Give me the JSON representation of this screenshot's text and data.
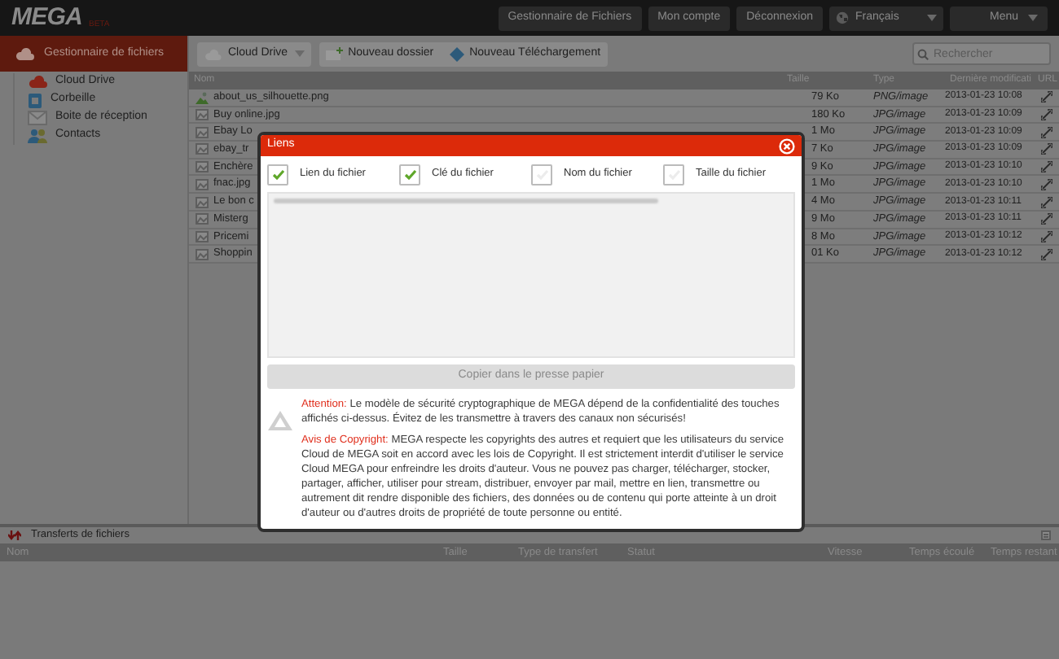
{
  "topbar": {
    "logo": "MEGA",
    "beta": "BETA",
    "nav": [
      "Gestionnaire de Fichiers",
      "Mon compte",
      "Déconnexion"
    ],
    "language": "Français",
    "menu": "Menu"
  },
  "sidebar": {
    "header": "Gestionnaire de fichiers",
    "items": [
      {
        "label": "Cloud Drive",
        "kind": "cloud"
      },
      {
        "label": "Corbeille",
        "kind": "trash"
      },
      {
        "label": "Boite de réception",
        "kind": "inbox"
      },
      {
        "label": "Contacts",
        "kind": "contacts"
      }
    ]
  },
  "toolbar": {
    "drive": "Cloud Drive",
    "new_folder": "Nouveau dossier",
    "new_upload": "Nouveau Téléchargement",
    "search_placeholder": "Rechercher"
  },
  "table": {
    "columns": [
      "Nom",
      "Taille",
      "Type",
      "Dernière modificati",
      "URL"
    ],
    "rows": [
      {
        "name": "about_us_silhouette.png",
        "size": "79 Ko",
        "type": "PNG/image",
        "date": "2013-01-23 10:08",
        "kind": "image"
      },
      {
        "name": "Buy online.jpg",
        "size": "180 Ko",
        "type": "JPG/image",
        "date": "2013-01-23 10:09",
        "kind": "file"
      },
      {
        "name": "Ebay Lo",
        "size": "1 Mo",
        "type": "JPG/image",
        "date": "2013-01-23 10:09",
        "kind": "file"
      },
      {
        "name": "ebay_tr",
        "size": "7 Ko",
        "type": "JPG/image",
        "date": "2013-01-23 10:09",
        "kind": "file"
      },
      {
        "name": "Enchère",
        "size": "9 Ko",
        "type": "JPG/image",
        "date": "2013-01-23 10:10",
        "kind": "file"
      },
      {
        "name": "fnac.jpg",
        "size": "1 Mo",
        "type": "JPG/image",
        "date": "2013-01-23 10:10",
        "kind": "file"
      },
      {
        "name": "Le bon c",
        "size": "4 Mo",
        "type": "JPG/image",
        "date": "2013-01-23 10:11",
        "kind": "file"
      },
      {
        "name": "Misterg",
        "size": "9 Mo",
        "type": "JPG/image",
        "date": "2013-01-23 10:11",
        "kind": "file"
      },
      {
        "name": "Pricemi",
        "size": "8 Mo",
        "type": "JPG/image",
        "date": "2013-01-23 10:12",
        "kind": "file"
      },
      {
        "name": "Shoppin",
        "size": "01 Ko",
        "type": "JPG/image",
        "date": "2013-01-23 10:12",
        "kind": "file"
      }
    ]
  },
  "transfers": {
    "title": "Transferts de fichiers",
    "columns": [
      "Nom",
      "Taille",
      "Type de transfert",
      "Statut",
      "Vitesse",
      "Temps écoulé",
      "Temps restant"
    ]
  },
  "dialog": {
    "title": "Liens",
    "options": [
      {
        "label": "Lien du fichier",
        "checked": true
      },
      {
        "label": "Clé du fichier",
        "checked": true
      },
      {
        "label": "Nom du fichier",
        "checked": false
      },
      {
        "label": "Taille du fichier",
        "checked": false
      }
    ],
    "copy_button": "Copier dans le presse papier",
    "warning": "**Attention:** Le modèle de sécurité cryptographique de MEGA dépend de la confidentialité des touches affichés ci-dessus. Évitez de les transmettre à travers des canaux non sécurisés!",
    "copyright": "**Avis de Copyright:** MEGA respecte les copyrights des autres et requiert que les utilisateurs du service Cloud de MEGA soit en accord avec les lois de Copyright. Il est strictement interdit d'utiliser le service Cloud MEGA pour enfreindre les droits d'auteur. Vous ne pouvez pas charger, télécharger, stocker, partager, afficher, utiliser pour stream, distribuer, envoyer par mail, mettre en lien, transmettre ou autrement dit rendre disponible des fichiers, des données ou de contenu qui porte atteinte à un droit d'auteur ou d'autres droits de propriété de toute personne ou entité."
  }
}
